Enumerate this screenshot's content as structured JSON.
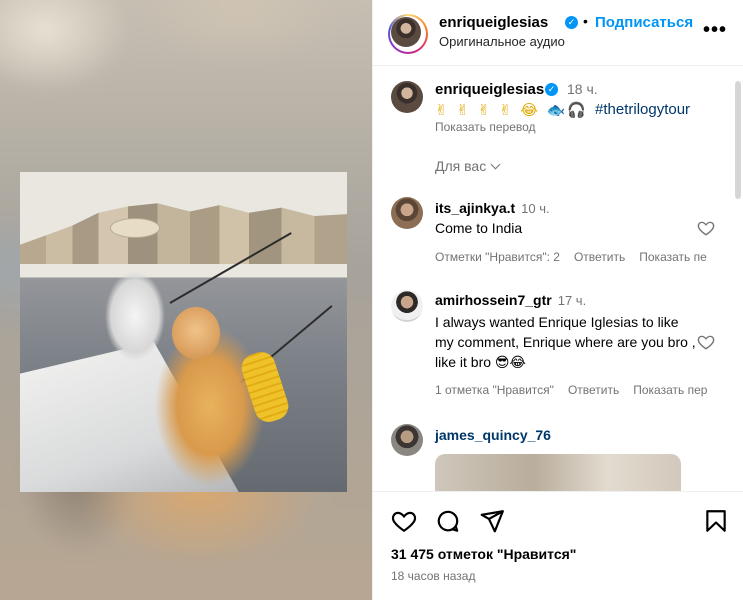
{
  "post": {
    "username": "enriqueiglesias",
    "follow_label": "Подписаться",
    "audio_label": "Оригинальное аудио"
  },
  "caption": {
    "username": "enriqueiglesias",
    "time": "18 ч.",
    "emoji": "✌ ✌ ✌ ✌ 😂 🐟🎧",
    "hashtag": "#thetrilogytour",
    "translate_label": "Показать перевод"
  },
  "for_you_label": "Для вас",
  "comments": [
    {
      "username": "its_ajinkya.t",
      "time": "10 ч.",
      "text": "Come to India",
      "likes": "Отметки \"Нравится\": 2",
      "reply": "Ответить",
      "translate": "Показать пе"
    },
    {
      "username": "amirhossein7_gtr",
      "time": "17 ч.",
      "text": "I always wanted Enrique Iglesias to like my comment, Enrique where are you bro , like it bro 😎😂",
      "likes": "1 отметка \"Нравится\"",
      "reply": "Ответить",
      "translate": "Показать пер"
    },
    {
      "username": "james_quincy_76"
    }
  ],
  "footer": {
    "likes_count": "31 475 отметок \"Нравится\"",
    "posted_ago": "18 часов назад"
  },
  "icons": {
    "like": "heart-icon",
    "comment": "comment-icon",
    "share": "share-icon",
    "save": "bookmark-icon",
    "more": "more-icon",
    "verified": "verified-badge-icon"
  },
  "colors": {
    "accent": "#0095f6",
    "hashtag": "#00376b",
    "muted": "#737373"
  }
}
